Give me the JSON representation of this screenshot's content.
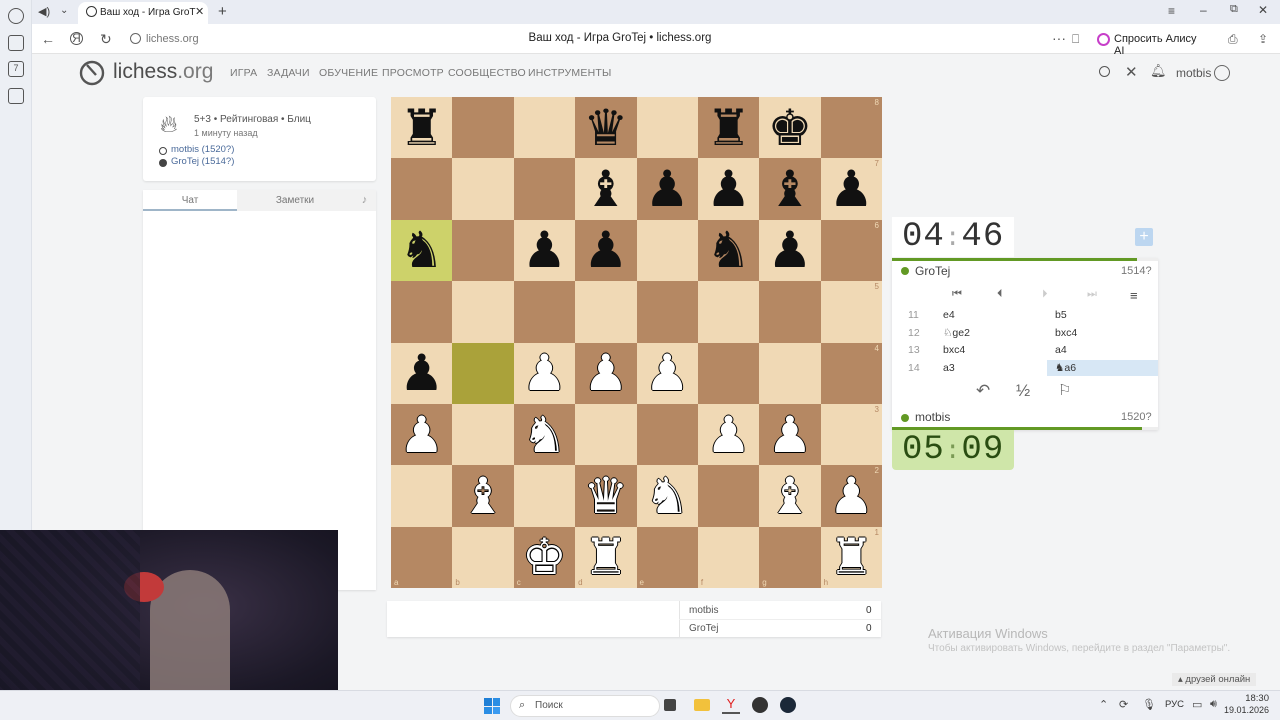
{
  "browser": {
    "tab_title": "Ваш ход - Игра GroT",
    "url": "lichess.org",
    "page_title": "Ваш ход - Игра GroTej • lichess.org",
    "alice_button": "Спросить Алису AI"
  },
  "header": {
    "logo_text": "lichess",
    "logo_suffix": ".org",
    "nav": [
      "ИГРА",
      "ЗАДАЧИ",
      "ОБУЧЕНИЕ",
      "ПРОСМОТР",
      "СООБЩЕСТВО",
      "ИНСТРУМЕНТЫ"
    ],
    "username": "motbis"
  },
  "game_info": {
    "mode": "5+3 • Рейтинговая • Блиц",
    "time_ago": "1 минуту назад",
    "white_player": "motbis (1520?)",
    "black_player": "GroTej (1514?)"
  },
  "chat": {
    "tabs": [
      "Чат",
      "Заметки"
    ]
  },
  "board": {
    "files": [
      "a",
      "b",
      "c",
      "d",
      "e",
      "f",
      "g",
      "h"
    ],
    "ranks": [
      "8",
      "7",
      "6",
      "5",
      "4",
      "3",
      "2",
      "1"
    ],
    "rows": [
      [
        "♜",
        "",
        "",
        "♛",
        "",
        "♜",
        "♚",
        ""
      ],
      [
        "",
        "",
        "",
        "♝",
        "♟",
        "♟",
        "♝",
        "♟"
      ],
      [
        "♞",
        "",
        "♟",
        "♟",
        "",
        "♞",
        "♟",
        ""
      ],
      [
        "",
        "",
        "",
        "",
        "",
        "",
        "",
        ""
      ],
      [
        "♟",
        "",
        "♙",
        "♙",
        "♙",
        "",
        "",
        ""
      ],
      [
        "♙",
        "",
        "♘",
        "",
        "",
        "♙",
        "♙",
        ""
      ],
      [
        "",
        "♗",
        "",
        "♕",
        "♘",
        "",
        "♗",
        "♙"
      ],
      [
        "",
        "",
        "♔",
        "♖",
        "",
        "",
        "",
        "♖"
      ]
    ],
    "last_move": [
      "a6",
      "b4"
    ]
  },
  "crosstable": {
    "rows": [
      {
        "name": "motbis",
        "score": "0"
      },
      {
        "name": "GroTej",
        "score": "0"
      }
    ]
  },
  "opponent": {
    "name": "GroTej",
    "rating": "1514?",
    "clock_min": "04",
    "clock_sec": "46"
  },
  "me": {
    "name": "motbis",
    "rating": "1520?",
    "clock_min": "05",
    "clock_sec": "09"
  },
  "moves": [
    {
      "num": "11",
      "white": "e4",
      "black": "b5"
    },
    {
      "num": "12",
      "white": "♘ge2",
      "black": "bxc4"
    },
    {
      "num": "13",
      "white": "bxc4",
      "black": "a4"
    },
    {
      "num": "14",
      "white": "a3",
      "black": "♞a6"
    }
  ],
  "game_controls": {
    "draw": "½"
  },
  "windows": {
    "watermark_title": "Активация Windows",
    "watermark_text": "Чтобы активировать Windows, перейдите в раздел \"Параметры\".",
    "friends_online": "друзей онлайн",
    "search": "Поиск",
    "lang": "РУС",
    "time": "18:30",
    "date": "19.01.2026"
  }
}
